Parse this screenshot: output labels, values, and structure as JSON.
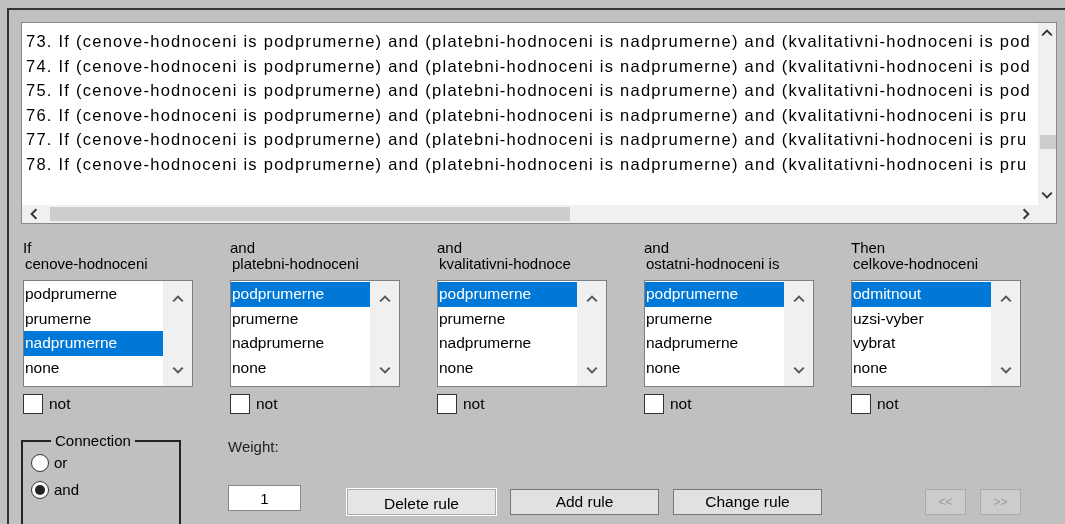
{
  "rules": {
    "lines": [
      "73. If (cenove-hodnoceni is podprumerne) and (platebni-hodnoceni is nadprumerne) and (kvalitativni-hodnoceni is pod",
      "74. If (cenove-hodnoceni is podprumerne) and (platebni-hodnoceni is nadprumerne) and (kvalitativni-hodnoceni is pod",
      "75. If (cenove-hodnoceni is podprumerne) and (platebni-hodnoceni is nadprumerne) and (kvalitativni-hodnoceni is pod",
      "76. If (cenove-hodnoceni is podprumerne) and (platebni-hodnoceni is nadprumerne) and (kvalitativni-hodnoceni is pru",
      "77. If (cenove-hodnoceni is podprumerne) and (platebni-hodnoceni is nadprumerne) and (kvalitativni-hodnoceni is pru",
      "78. If (cenove-hodnoceni is podprumerne) and (platebni-hodnoceni is nadprumerne) and (kvalitativni-hodnoceni is pru"
    ]
  },
  "variables": [
    {
      "prefix": "If",
      "name": "cenove-hodnoceni",
      "options": [
        {
          "label": "podprumerne",
          "selected": false
        },
        {
          "label": "prumerne",
          "selected": false
        },
        {
          "label": "nadprumerne",
          "selected": true
        },
        {
          "label": "none",
          "selected": false
        }
      ],
      "negate": {
        "label": "not",
        "checked": false
      }
    },
    {
      "prefix": "and",
      "name": "platebni-hodnoceni",
      "options": [
        {
          "label": "podprumerne",
          "selected": true
        },
        {
          "label": "prumerne",
          "selected": false
        },
        {
          "label": "nadprumerne",
          "selected": false
        },
        {
          "label": "none",
          "selected": false
        }
      ],
      "negate": {
        "label": "not",
        "checked": false
      }
    },
    {
      "prefix": "and",
      "name": "kvalitativni-hodnoce",
      "options": [
        {
          "label": "podprumerne",
          "selected": true
        },
        {
          "label": "prumerne",
          "selected": false
        },
        {
          "label": "nadprumerne",
          "selected": false
        },
        {
          "label": "none",
          "selected": false
        }
      ],
      "negate": {
        "label": "not",
        "checked": false
      }
    },
    {
      "prefix": "and",
      "name": "ostatni-hodnoceni is",
      "options": [
        {
          "label": "podprumerne",
          "selected": true
        },
        {
          "label": "prumerne",
          "selected": false
        },
        {
          "label": "nadprumerne",
          "selected": false
        },
        {
          "label": "none",
          "selected": false
        }
      ],
      "negate": {
        "label": "not",
        "checked": false
      }
    },
    {
      "prefix": "Then",
      "name": "celkove-hodnoceni",
      "options": [
        {
          "label": "odmitnout",
          "selected": true
        },
        {
          "label": "uzsi-vyber",
          "selected": false
        },
        {
          "label": "vybrat",
          "selected": false
        },
        {
          "label": "none",
          "selected": false
        }
      ],
      "negate": {
        "label": "not",
        "checked": false
      }
    }
  ],
  "connection": {
    "title": "Connection",
    "options": [
      {
        "label": "or",
        "selected": false
      },
      {
        "label": "and",
        "selected": true
      }
    ]
  },
  "weight": {
    "label": "Weight:",
    "value": "1"
  },
  "buttons": [
    {
      "label": "Delete rule",
      "focused": true
    },
    {
      "label": "Add rule",
      "focused": false
    },
    {
      "label": "Change rule",
      "focused": false
    }
  ],
  "nav": [
    {
      "label": "<<",
      "disabled": true
    },
    {
      "label": ">>",
      "disabled": true
    }
  ]
}
